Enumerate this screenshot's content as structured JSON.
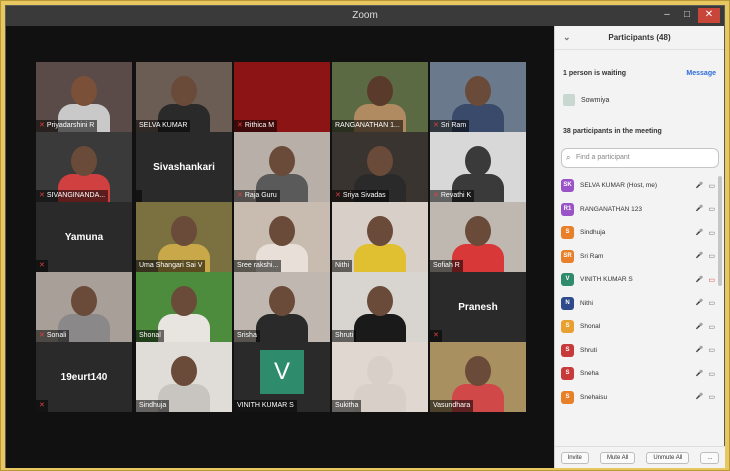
{
  "window": {
    "title": "Zoom",
    "minimize": "–",
    "maximize": "□",
    "close": "✕"
  },
  "gallery": {
    "tiles": [
      {
        "name": "Priyadarshini R",
        "muted": true,
        "type": "video",
        "bg": "#5a4a48",
        "skin": "#7a5039",
        "shirt": "#c9c9c9"
      },
      {
        "name": "SELVA KUMAR",
        "muted": false,
        "type": "video",
        "bg": "#6b5c54",
        "skin": "#6a4a38",
        "shirt": "#2a2a2a"
      },
      {
        "name": "Rithica M",
        "muted": true,
        "type": "video",
        "bg": "#8c1414",
        "skin": "#8c1414",
        "shirt": "#8c1414"
      },
      {
        "name": "RANGANATHAN 1...",
        "muted": false,
        "type": "video",
        "bg": "#5c6a44",
        "skin": "#5a3a2a",
        "shirt": "#b08a60"
      },
      {
        "name": "Sri Ram",
        "muted": true,
        "type": "video",
        "bg": "#6a7a8c",
        "skin": "#6a4a38",
        "shirt": "#3a4a6a"
      },
      {
        "name": "SIVANGINANDA...",
        "muted": true,
        "type": "video",
        "bg": "#3a3a3a",
        "skin": "#6a4a38",
        "shirt": "#d04040"
      },
      {
        "name": "Sivashankari",
        "muted": false,
        "type": "name"
      },
      {
        "name": "Raja Guru",
        "muted": true,
        "type": "video",
        "bg": "#b8b0a8",
        "skin": "#6a4a38",
        "shirt": "#5a5a5a"
      },
      {
        "name": "Sriya Sivadas",
        "muted": true,
        "type": "video",
        "bg": "#3a3430",
        "skin": "#6a4a38",
        "shirt": "#2a2a2a"
      },
      {
        "name": "Revathi K",
        "muted": true,
        "type": "video",
        "bg": "#d8d8d8",
        "skin": "#3a3a3a",
        "shirt": "#3a3a3a"
      },
      {
        "name": "Yamuna",
        "muted": true,
        "type": "name"
      },
      {
        "name": "Uma Shangari Sai V",
        "muted": false,
        "type": "video",
        "bg": "#7a7040",
        "skin": "#6a4a38",
        "shirt": "#c8a848"
      },
      {
        "name": "Sree rakshi...",
        "muted": false,
        "type": "video",
        "bg": "#c8bcb0",
        "skin": "#6a4a38",
        "shirt": "#e8e0d8"
      },
      {
        "name": "Nithi",
        "muted": false,
        "type": "video",
        "bg": "#d8d0c8",
        "skin": "#6a4a38",
        "shirt": "#e0c030"
      },
      {
        "name": "Sofiah R",
        "muted": false,
        "type": "video",
        "bg": "#bfb8b0",
        "skin": "#6a4a38",
        "shirt": "#d83838"
      },
      {
        "name": "Sonali",
        "muted": true,
        "type": "video",
        "bg": "#a8a098",
        "skin": "#6a4a38",
        "shirt": "#8a8888"
      },
      {
        "name": "Shonal",
        "muted": false,
        "type": "video",
        "bg": "#4c8c3c",
        "skin": "#6a4a38",
        "shirt": "#e8e4e0"
      },
      {
        "name": "Srisha",
        "muted": false,
        "type": "video",
        "bg": "#c0b8b0",
        "skin": "#6a4a38",
        "shirt": "#2a2a2a"
      },
      {
        "name": "Shruti",
        "muted": false,
        "type": "video",
        "bg": "#d8d4d0",
        "skin": "#6a4a38",
        "shirt": "#1a1a1a"
      },
      {
        "name": "Pranesh",
        "muted": true,
        "type": "name"
      },
      {
        "name": "19eurt140",
        "muted": true,
        "type": "name"
      },
      {
        "name": "Sindhuja",
        "muted": false,
        "type": "video",
        "speaking": true,
        "bg": "#e0dcd8",
        "skin": "#6a4a38",
        "shirt": "#c8c4c0"
      },
      {
        "name": "VINITH KUMAR S",
        "muted": false,
        "type": "avatar",
        "letter": "V"
      },
      {
        "name": "Sukitha",
        "muted": false,
        "type": "video",
        "bg": "#e0d8d0",
        "skin": "#d8d0c8",
        "shirt": "#d8d0c8"
      },
      {
        "name": "Vasundhara",
        "muted": false,
        "type": "video",
        "bg": "#a89060",
        "skin": "#6a4a38",
        "shirt": "#d04848"
      }
    ]
  },
  "panel": {
    "back": "⌄",
    "title": "Participants (48)",
    "waiting_label": "1 person is waiting",
    "message_label": "Message",
    "waiting_person": "Sowmiya",
    "in_meeting_label": "38 participants in the meeting",
    "search_placeholder": "Find a participant",
    "search_icon": "⌕",
    "participants": [
      {
        "initials": "SK",
        "name": "SELVA KUMAR (Host, me)",
        "color": "#9a52c8",
        "mic": "🎤",
        "cam": "▭",
        "cam_muted": false
      },
      {
        "initials": "R1",
        "name": "RANGANATHAN 123",
        "color": "#9a52c8",
        "mic": "🎤",
        "cam": "▭",
        "cam_muted": false
      },
      {
        "initials": "S",
        "name": "Sindhuja",
        "color": "#e8802a",
        "mic": "🎤",
        "cam": "▭",
        "cam_muted": false
      },
      {
        "initials": "SR",
        "name": "Sri Ram",
        "color": "#e8802a",
        "mic": "🎤",
        "cam": "▭",
        "cam_muted": false
      },
      {
        "initials": "V",
        "name": "VINITH KUMAR S",
        "color": "#2e8b6c",
        "mic": "🎤",
        "cam": "▭",
        "cam_muted": true
      },
      {
        "initials": "N",
        "name": "Nithi",
        "color": "#2c4a8c",
        "mic": "🎤",
        "cam": "▭",
        "cam_muted": false
      },
      {
        "initials": "S",
        "name": "Shonal",
        "color": "#e8a030",
        "mic": "🎤",
        "cam": "▭",
        "cam_muted": false
      },
      {
        "initials": "S",
        "name": "Shruti",
        "color": "#c83a3a",
        "mic": "🎤",
        "cam": "▭",
        "cam_muted": false
      },
      {
        "initials": "S",
        "name": "Sneha",
        "color": "#c83a3a",
        "mic": "🎤",
        "cam": "▭",
        "cam_muted": false
      },
      {
        "initials": "S",
        "name": "Snehaisu",
        "color": "#e8802a",
        "mic": "🎤",
        "cam": "▭",
        "cam_muted": false
      }
    ],
    "footer": {
      "invite": "Invite",
      "mute_all": "Mute All",
      "unmute_all": "Unmute All",
      "more": "..."
    }
  }
}
